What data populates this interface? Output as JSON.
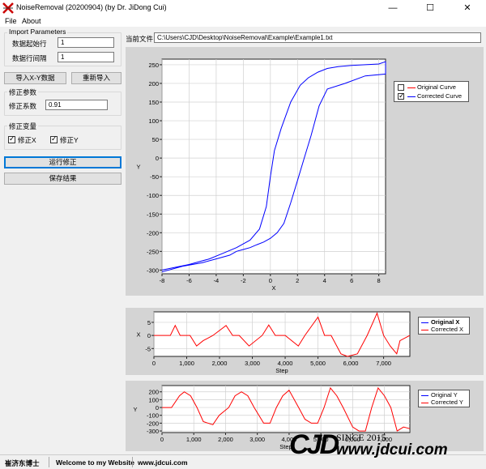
{
  "window": {
    "title": "NoiseRemoval (20200904) (by Dr. JiDong Cui)",
    "minimize_glyph": "—",
    "maximize_glyph": "☐",
    "close_glyph": "✕"
  },
  "menu": {
    "items": [
      "File",
      "About"
    ]
  },
  "import": {
    "group_title": "Import Parameters",
    "start_row_label": "数据起始行",
    "start_row_value": "1",
    "row_interval_label": "数据行间隔",
    "row_interval_value": "1",
    "import_xy_button": "导入X-Y数据",
    "reimport_button": "重新导入"
  },
  "correction": {
    "group_title": "修正参数",
    "coef_label": "修正系数",
    "coef_value": "0.91"
  },
  "variables": {
    "group_title": "修正变量",
    "fix_x_label": "修正X",
    "fix_x_checked": true,
    "fix_y_label": "修正Y",
    "fix_y_checked": true
  },
  "actions": {
    "run_button": "运行修正",
    "save_button": "保存结果"
  },
  "file": {
    "label": "当前文件",
    "path": "C:\\Users\\CJD\\Desktop\\NoiseRemoval\\Example\\Example1.txt"
  },
  "colors": {
    "original": "#ff0000",
    "corrected": "#0000ff",
    "panel": "#d4d4d4"
  },
  "chart_data": [
    {
      "type": "line",
      "name": "main-xy",
      "xlabel": "X",
      "ylabel": "Y",
      "xlim": [
        -8,
        8.5
      ],
      "ylim": [
        -310,
        265
      ],
      "xticks": [
        -8,
        -6,
        -4,
        -2,
        0,
        2,
        4,
        6,
        8
      ],
      "yticks": [
        -300,
        -250,
        -200,
        -150,
        -100,
        -50,
        0,
        50,
        100,
        150,
        200,
        250
      ],
      "grid": true,
      "legend": {
        "position": "right",
        "entries": [
          {
            "name": "Original Curve",
            "checked": false,
            "color": "#ff0000"
          },
          {
            "name": "Corrected Curve",
            "checked": true,
            "color": "#0000ff"
          }
        ]
      },
      "series": [
        {
          "name": "Corrected Curve",
          "color": "#0000ff",
          "x": [
            -8,
            -6,
            -4.5,
            -3.5,
            -2.5,
            -1.5,
            -0.8,
            -0.3,
            0,
            0.3,
            0.8,
            1.5,
            2.2,
            2.8,
            3.5,
            4.2,
            5,
            6,
            7,
            8,
            8.5,
            8.5,
            7,
            5.5,
            4.2,
            3.6,
            3,
            2.5,
            2,
            1.5,
            1,
            0.5,
            0,
            -0.5,
            -1,
            -1.5,
            -2,
            -2.5,
            -3,
            -4,
            -5,
            -6.5,
            -8
          ],
          "y": [
            -300,
            -285,
            -270,
            -255,
            -240,
            -220,
            -190,
            -130,
            -50,
            20,
            80,
            150,
            195,
            215,
            230,
            240,
            245,
            248,
            250,
            252,
            258,
            225,
            220,
            200,
            185,
            140,
            60,
            0,
            -60,
            -120,
            -175,
            -200,
            -215,
            -225,
            -232,
            -240,
            -245,
            -250,
            -260,
            -270,
            -280,
            -290,
            -305
          ]
        }
      ]
    },
    {
      "type": "line",
      "name": "x-vs-step",
      "xlabel": "Step",
      "ylabel": "X",
      "xlim": [
        0,
        7800
      ],
      "ylim": [
        -8,
        9
      ],
      "xticks": [
        0,
        1000,
        2000,
        3000,
        4000,
        5000,
        6000,
        7000
      ],
      "yticks": [
        -5,
        0,
        5
      ],
      "grid": true,
      "legend": {
        "position": "right",
        "entries": [
          {
            "name": "Original X",
            "color": "#0000ff"
          },
          {
            "name": "Corrected X",
            "color": "#ff0000"
          }
        ]
      },
      "series": [
        {
          "name": "Corrected X",
          "color": "#ff0000",
          "x": [
            0,
            500,
            650,
            800,
            1100,
            1300,
            1500,
            1800,
            2200,
            2400,
            2600,
            2900,
            3300,
            3500,
            3700,
            4000,
            4400,
            4600,
            5000,
            5200,
            5400,
            5700,
            5900,
            6200,
            6500,
            6800,
            7000,
            7200,
            7400,
            7500,
            7800
          ],
          "y": [
            0,
            0,
            3.8,
            0,
            0,
            -4,
            -2,
            0,
            3.8,
            0,
            0,
            -4,
            0,
            4,
            0,
            0,
            -4,
            0,
            7,
            0,
            0,
            -7,
            -8,
            -7,
            0,
            8.5,
            0,
            -4,
            -7,
            -2,
            0
          ]
        }
      ]
    },
    {
      "type": "line",
      "name": "y-vs-step",
      "xlabel": "Step",
      "ylabel": "Y",
      "xlim": [
        0,
        7800
      ],
      "ylim": [
        -320,
        280
      ],
      "xticks": [
        0,
        1000,
        2000,
        3000,
        4000,
        5000,
        6000,
        7000
      ],
      "yticks": [
        -300,
        -200,
        -100,
        0,
        100,
        200
      ],
      "grid": true,
      "legend": {
        "position": "right",
        "entries": [
          {
            "name": "Original Y",
            "color": "#0000ff"
          },
          {
            "name": "Corrected Y",
            "color": "#ff0000"
          }
        ]
      },
      "series": [
        {
          "name": "Corrected Y",
          "color": "#ff0000",
          "x": [
            0,
            300,
            550,
            700,
            900,
            1100,
            1300,
            1600,
            1800,
            2100,
            2300,
            2500,
            2700,
            2900,
            3200,
            3400,
            3600,
            3800,
            4000,
            4300,
            4500,
            4700,
            4900,
            5100,
            5300,
            5500,
            5700,
            6000,
            6200,
            6400,
            6600,
            6800,
            7000,
            7200,
            7400,
            7600,
            7800
          ],
          "y": [
            0,
            0,
            150,
            200,
            150,
            0,
            -180,
            -220,
            -100,
            0,
            150,
            200,
            150,
            0,
            -200,
            -200,
            0,
            150,
            220,
            0,
            -150,
            -200,
            -200,
            0,
            250,
            150,
            0,
            -250,
            -300,
            -300,
            0,
            250,
            150,
            0,
            -300,
            -250,
            -270
          ]
        }
      ]
    }
  ],
  "status": {
    "author": "崔济东博士",
    "welcome": "Welcome to my Website",
    "site": "www.jdcui.com"
  },
  "watermark": {
    "logo": "CJD",
    "since": "SINCE 2015",
    "site": "www.jdcui.com"
  }
}
